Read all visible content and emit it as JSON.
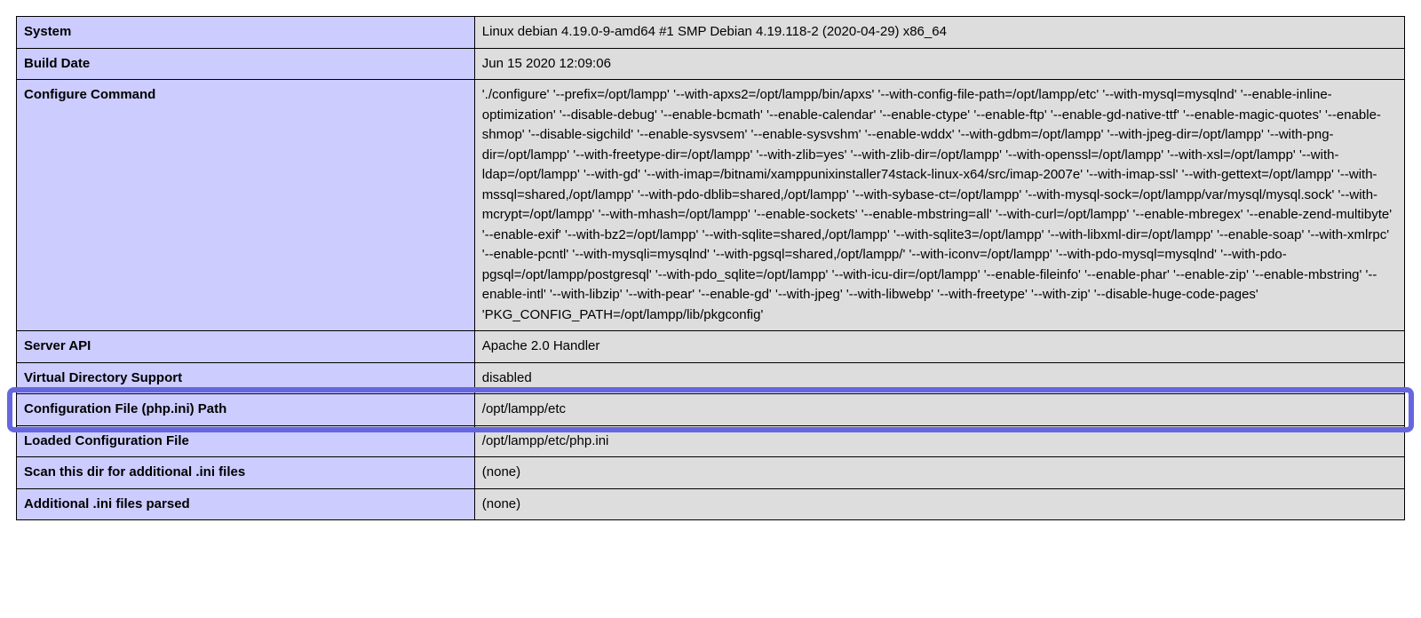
{
  "rows": [
    {
      "label": "System",
      "value": "Linux debian 4.19.0-9-amd64 #1 SMP Debian 4.19.118-2 (2020-04-29) x86_64"
    },
    {
      "label": "Build Date",
      "value": "Jun 15 2020 12:09:06"
    },
    {
      "label": "Configure Command",
      "value": "'./configure' '--prefix=/opt/lampp' '--with-apxs2=/opt/lampp/bin/apxs' '--with-config-file-path=/opt/lampp/etc' '--with-mysql=mysqlnd' '--enable-inline-optimization' '--disable-debug' '--enable-bcmath' '--enable-calendar' '--enable-ctype' '--enable-ftp' '--enable-gd-native-ttf' '--enable-magic-quotes' '--enable-shmop' '--disable-sigchild' '--enable-sysvsem' '--enable-sysvshm' '--enable-wddx' '--with-gdbm=/opt/lampp' '--with-jpeg-dir=/opt/lampp' '--with-png-dir=/opt/lampp' '--with-freetype-dir=/opt/lampp' '--with-zlib=yes' '--with-zlib-dir=/opt/lampp' '--with-openssl=/opt/lampp' '--with-xsl=/opt/lampp' '--with-ldap=/opt/lampp' '--with-gd' '--with-imap=/bitnami/xamppunixinstaller74stack-linux-x64/src/imap-2007e' '--with-imap-ssl' '--with-gettext=/opt/lampp' '--with-mssql=shared,/opt/lampp' '--with-pdo-dblib=shared,/opt/lampp' '--with-sybase-ct=/opt/lampp' '--with-mysql-sock=/opt/lampp/var/mysql/mysql.sock' '--with-mcrypt=/opt/lampp' '--with-mhash=/opt/lampp' '--enable-sockets' '--enable-mbstring=all' '--with-curl=/opt/lampp' '--enable-mbregex' '--enable-zend-multibyte' '--enable-exif' '--with-bz2=/opt/lampp' '--with-sqlite=shared,/opt/lampp' '--with-sqlite3=/opt/lampp' '--with-libxml-dir=/opt/lampp' '--enable-soap' '--with-xmlrpc' '--enable-pcntl' '--with-mysqli=mysqlnd' '--with-pgsql=shared,/opt/lampp/' '--with-iconv=/opt/lampp' '--with-pdo-mysql=mysqlnd' '--with-pdo-pgsql=/opt/lampp/postgresql' '--with-pdo_sqlite=/opt/lampp' '--with-icu-dir=/opt/lampp' '--enable-fileinfo' '--enable-phar' '--enable-zip' '--enable-mbstring' '--enable-intl' '--with-libzip' '--with-pear' '--enable-gd' '--with-jpeg' '--with-libwebp' '--with-freetype' '--with-zip' '--disable-huge-code-pages' 'PKG_CONFIG_PATH=/opt/lampp/lib/pkgconfig'"
    },
    {
      "label": "Server API",
      "value": "Apache 2.0 Handler"
    },
    {
      "label": "Virtual Directory Support",
      "value": "disabled"
    },
    {
      "label": "Configuration File (php.ini) Path",
      "value": "/opt/lampp/etc"
    },
    {
      "label": "Loaded Configuration File",
      "value": "/opt/lampp/etc/php.ini"
    },
    {
      "label": "Scan this dir for additional .ini files",
      "value": "(none)"
    },
    {
      "label": "Additional .ini files parsed",
      "value": "(none)"
    }
  ],
  "highlight_row_index": 5
}
